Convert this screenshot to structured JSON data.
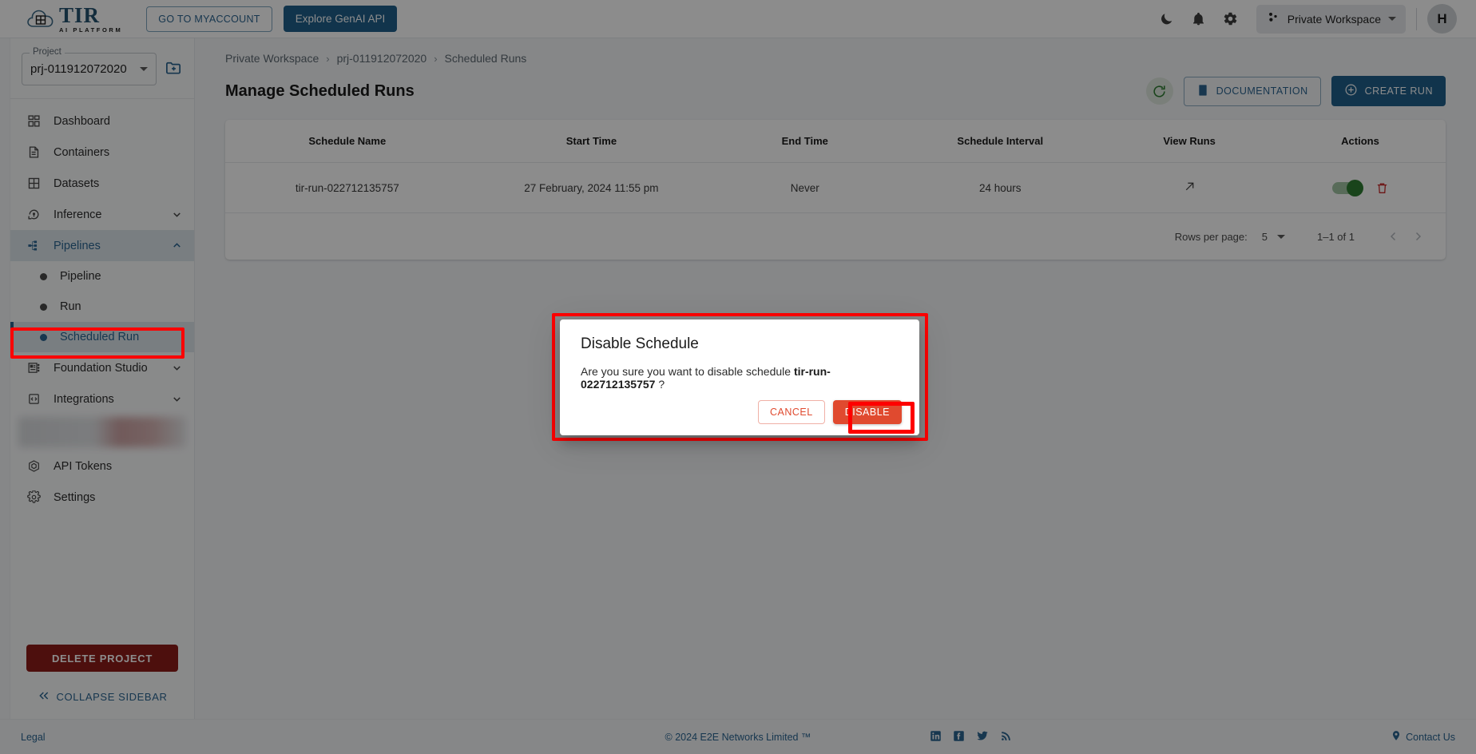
{
  "topbar": {
    "logo_title": "TIR",
    "logo_subtitle": "AI PLATFORM",
    "myaccount_label": "GO TO MYACCOUNT",
    "genai_label": "Explore GenAI API",
    "icons": [
      "moon-icon",
      "bell-icon",
      "gear-icon"
    ],
    "workspace_label": "Private Workspace",
    "avatar_initial": "H"
  },
  "sidebar": {
    "project_label": "Project",
    "project_value": "prj-011912072020",
    "new_folder_icon": "new-folder-icon",
    "items": [
      {
        "label": "Dashboard",
        "icon": "dashboard-icon",
        "expandable": false
      },
      {
        "label": "Containers",
        "icon": "document-icon",
        "expandable": false
      },
      {
        "label": "Datasets",
        "icon": "grid-icon",
        "expandable": false
      },
      {
        "label": "Inference",
        "icon": "inference-icon",
        "expandable": true,
        "expanded": false
      },
      {
        "label": "Pipelines",
        "icon": "pipelines-icon",
        "expandable": true,
        "expanded": true
      }
    ],
    "pipeline_subitems": [
      {
        "label": "Pipeline",
        "selected": false
      },
      {
        "label": "Run",
        "selected": false
      },
      {
        "label": "Scheduled Run",
        "selected": true
      }
    ],
    "items_after": [
      {
        "label": "Foundation Studio",
        "icon": "studio-icon",
        "expandable": true,
        "expanded": false
      },
      {
        "label": "Integrations",
        "icon": "integrations-icon",
        "expandable": true,
        "expanded": false
      }
    ],
    "items_bottom": [
      {
        "label": "API Tokens",
        "icon": "token-icon",
        "expandable": false
      },
      {
        "label": "Settings",
        "icon": "settings-gear-icon",
        "expandable": false
      }
    ],
    "delete_project_label": "DELETE PROJECT",
    "collapse_label": "COLLAPSE SIDEBAR"
  },
  "main": {
    "breadcrumb": [
      "Private Workspace",
      "prj-011912072020",
      "Scheduled Runs"
    ],
    "page_title": "Manage Scheduled Runs",
    "refresh_icon": "refresh-icon",
    "documentation_label": "DOCUMENTATION",
    "create_run_label": "CREATE RUN"
  },
  "table": {
    "headers": [
      "Schedule Name",
      "Start Time",
      "End Time",
      "Schedule Interval",
      "View Runs",
      "Actions"
    ],
    "rows": [
      {
        "schedule_name": "tir-run-022712135757",
        "start_time": "27 February, 2024 11:55 pm",
        "end_time": "Never",
        "schedule_interval": "24 hours",
        "view_runs_icon": "external-link-arrow-icon",
        "enabled": true,
        "delete_icon": "trash-icon"
      }
    ]
  },
  "pagination": {
    "rows_per_page_label": "Rows per page:",
    "rows_per_page_value": "5",
    "range_label": "1–1 of 1",
    "prev_icon": "chevron-left-icon",
    "next_icon": "chevron-right-icon"
  },
  "modal": {
    "title": "Disable Schedule",
    "message_prefix": "Are you sure you want to disable schedule ",
    "message_target": "tir-run-022712135757",
    "message_suffix": " ?",
    "cancel_label": "CANCEL",
    "disable_label": "DISABLE"
  },
  "footer": {
    "legal_label": "Legal",
    "copyright": "© 2024 E2E Networks Limited ™",
    "social": [
      "linkedin-icon",
      "facebook-icon",
      "twitter-icon",
      "rss-icon"
    ],
    "contact_label": "Contact Us"
  },
  "colors": {
    "brand_blue": "#1f5f8b",
    "link_blue": "#2a6491",
    "danger_red": "#e04a2f",
    "delete_maroon": "#8c1d18",
    "toggle_green": "#2e7d32",
    "highlight_red": "#fe0000"
  }
}
